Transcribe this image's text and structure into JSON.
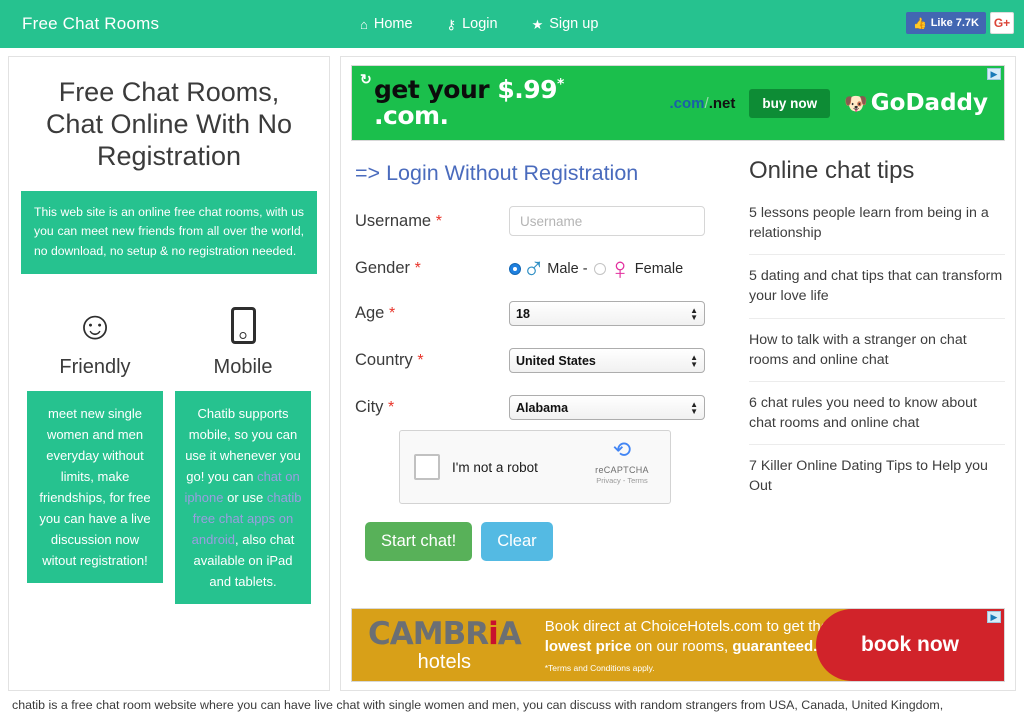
{
  "header": {
    "brand": "Free Chat Rooms",
    "nav": [
      {
        "label": "Home",
        "icon": "home-icon",
        "glyph": "⌂"
      },
      {
        "label": "Login",
        "icon": "key-icon",
        "glyph": "⚷"
      },
      {
        "label": "Sign up",
        "icon": "star-icon",
        "glyph": "★"
      }
    ],
    "facebook_like": {
      "label": "Like 7.7K",
      "glyph": "👍",
      "color": "#4267b2"
    },
    "google_plus": {
      "label": "G+",
      "color": "#db4437"
    },
    "accent_color": "#26c28f"
  },
  "left": {
    "hero_title": "Free Chat Rooms, Chat Online With No Registration",
    "intro": "This web site is an online free chat rooms, with us you can meet new friends from all over the world, no download, no setup & no registration needed.",
    "features": [
      {
        "icon": "smiley-face-icon",
        "glyph": "☺",
        "name": "Friendly",
        "text": "meet new single women and men everyday without limits, make friendships, for free you can have a live discussion now witout registration!"
      },
      {
        "icon": "mobile-phone-icon",
        "glyph": "",
        "name": "Mobile",
        "text_before": "Chatib supports mobile, so you can use it whenever you go! you can ",
        "link1": "chat on iphone",
        "text_mid": " or use ",
        "link2": "chatib free chat apps on android",
        "text_after": ", also chat available on iPad and tablets."
      }
    ]
  },
  "ads": {
    "godaddy": {
      "name": "godaddy-ad",
      "headline_1": "get your",
      "headline_price": "$.99",
      "headline_star": "*",
      "headline_2": ".com.",
      "domains_com": ".com",
      "domains_slash": "/",
      "domains_net": ".net",
      "cta": "buy now",
      "brand": "GoDaddy",
      "brand_tm": "™",
      "refresh_icon": "↻",
      "bg_color": "#1bbf4c"
    },
    "cambria": {
      "name": "cambria-hotels-ad",
      "logo_1": "CAMBR",
      "logo_i": "i",
      "logo_2": "A",
      "logo_sub": "hotels",
      "line1": "Book direct at ChoiceHotels.com to get the",
      "line2_bold_a": "lowest price",
      "line2_mid": " on our rooms, ",
      "line2_bold_b": "guaranteed.*",
      "terms": "*Terms and Conditions apply.",
      "cta": "book now",
      "bg_color": "#d8a018",
      "cta_color": "#d1232a"
    }
  },
  "form": {
    "title": "=> Login Without Registration",
    "title_color": "#4a6bbd",
    "required_mark": "*",
    "username": {
      "label": "Username",
      "placeholder": "Username",
      "value": ""
    },
    "gender": {
      "label": "Gender",
      "male_label": "Male -",
      "female_label": "Female",
      "male_symbol": "♂",
      "female_symbol": "♀",
      "selected": "male"
    },
    "age": {
      "label": "Age",
      "value": "18"
    },
    "country": {
      "label": "Country",
      "value": "United States"
    },
    "city": {
      "label": "City",
      "value": "Alabama"
    },
    "captcha": {
      "label": "I'm not a robot",
      "brand": "reCAPTCHA",
      "terms": "Privacy - Terms"
    },
    "start_button": "Start chat!",
    "clear_button": "Clear",
    "start_color": "#58b159",
    "clear_color": "#54bae3"
  },
  "tips": {
    "title": "Online chat tips",
    "items": [
      "5 lessons people learn from being in a relationship",
      "5 dating and chat tips that can transform your love life",
      "How to talk with a stranger on chat rooms and online chat",
      "6 chat rules you need to know about chat rooms and online chat",
      "7 Killer Online Dating Tips to Help you Out"
    ]
  },
  "footer": {
    "blurb": "chatib is a free chat room website where you can have live chat with single women and men, you can discuss with random strangers from USA, Canada, United Kingdom,"
  }
}
